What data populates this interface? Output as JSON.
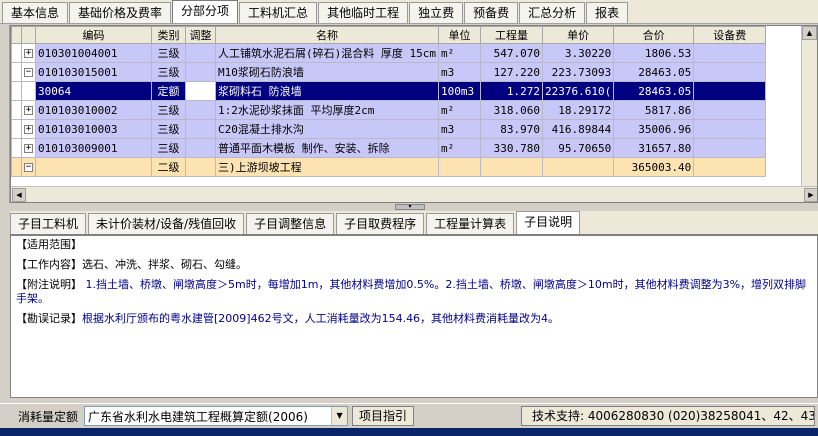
{
  "top_tabs": [
    "基本信息",
    "基础价格及费率",
    "分部分项",
    "工料机汇总",
    "其他临时工程",
    "独立费",
    "预备费",
    "汇总分析",
    "报表"
  ],
  "top_active": 2,
  "grid": {
    "columns": [
      "编码",
      "类别",
      "调整",
      "名称",
      "单位",
      "工程量",
      "单价",
      "合价",
      "设备费"
    ],
    "rows": [
      {
        "code": "010301004001",
        "type": "三级",
        "adj": "",
        "name": "人工铺筑水泥石屑(碎石)混合料 厚度 15cm",
        "unit": "m²",
        "qty": "547.070",
        "price": "3.30220",
        "total": "1806.53",
        "equip": "",
        "exp": "+"
      },
      {
        "code": "010103015001",
        "type": "三级",
        "adj": "",
        "name": "M10浆砌石防浪墙",
        "unit": "m3",
        "qty": "127.220",
        "price": "223.73093",
        "total": "28463.05",
        "equip": "",
        "exp": "−"
      },
      {
        "code": "30064",
        "type": "定额",
        "adj": "",
        "name": "浆砌料石 防浪墙",
        "unit": "100m3",
        "qty": "1.272",
        "price": "22376.610(",
        "total": "28463.05",
        "equip": "",
        "exp": ""
      },
      {
        "code": "010103010002",
        "type": "三级",
        "adj": "",
        "name": "1:2水泥砂浆抹面 平均厚度2cm",
        "unit": "m²",
        "qty": "318.060",
        "price": "18.29172",
        "total": "5817.86",
        "equip": "",
        "exp": "+"
      },
      {
        "code": "010103010003",
        "type": "三级",
        "adj": "",
        "name": "C20混凝土排水沟",
        "unit": "m3",
        "qty": "83.970",
        "price": "416.89844",
        "total": "35006.96",
        "equip": "",
        "exp": "+"
      },
      {
        "code": "010103009001",
        "type": "三级",
        "adj": "",
        "name": "普通平面木模板 制作、安装、拆除",
        "unit": "m²",
        "qty": "330.780",
        "price": "95.70650",
        "total": "31657.80",
        "equip": "",
        "exp": "+"
      },
      {
        "code": "",
        "type": "二级",
        "adj": "",
        "name": "三)上游坝坡工程",
        "unit": "",
        "qty": "",
        "price": "",
        "total": "365003.40",
        "equip": "",
        "exp": "−"
      }
    ]
  },
  "bottom_tabs": [
    "子目工料机",
    "未计价装材/设备/残值回收",
    "子目调整信息",
    "子目取费程序",
    "工程量计算表",
    "子目说明"
  ],
  "bottom_active": 5,
  "description": {
    "scope_label": "【适用范围】",
    "work_label": "【工作内容】",
    "work_text": "选石、冲洗、拌浆、砌石、勾缝。",
    "note_label": "【附注说明】",
    "note_text": "1.挡土墙、桥墩、闸墩高度＞5m时，每增加1m，其他材料费增加0.5%。2.挡土墙、桥墩、闸墩高度＞10m时，其他材料费调整为3%，增列双排脚手架。",
    "errata_label": "【勘误记录】",
    "errata_text": "根据水利厅颁布的粤水建管[2009]462号文，人工消耗量改为154.46，其他材料费消耗量改为4。"
  },
  "status": {
    "quota_label": "消耗量定额",
    "quota_value": "广东省水利水电建筑工程概算定额(2006)",
    "guide_button": "项目指引",
    "support_text": "技术支持:  4006280830 (020)38258041、42、43"
  }
}
